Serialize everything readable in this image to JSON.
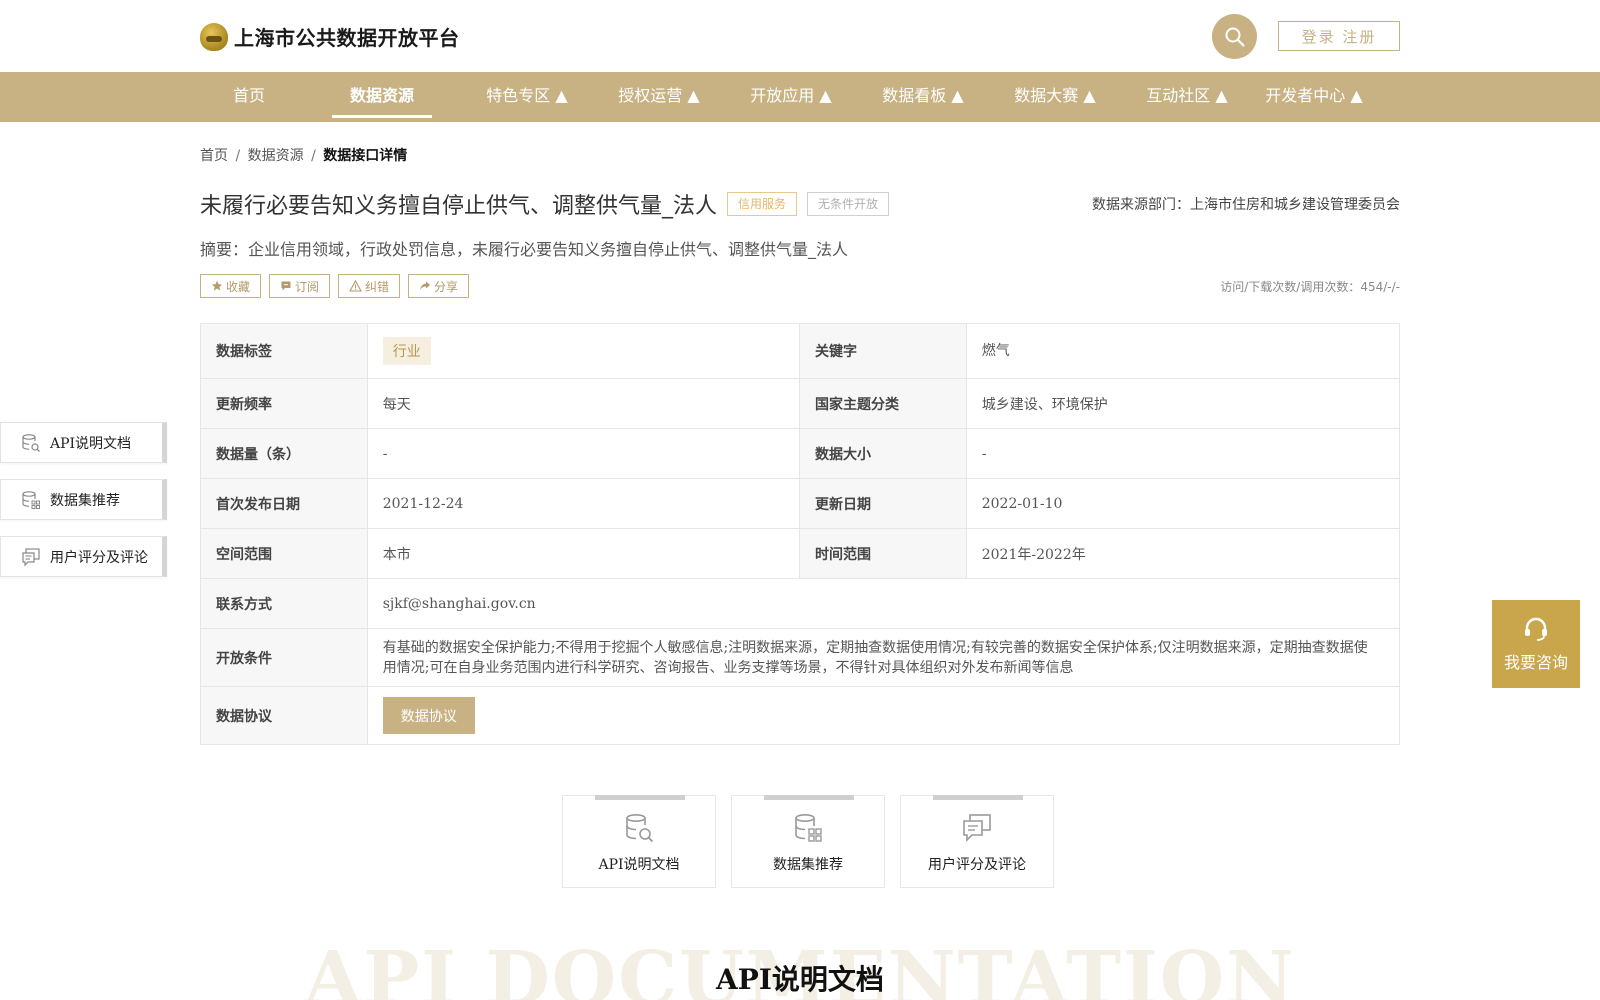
{
  "header": {
    "logo_text": "上海市公共数据开放平台",
    "login_label": "登录 注册",
    "accent_color": "#c8b283"
  },
  "nav": {
    "items": [
      {
        "label": "首页"
      },
      {
        "label": "数据资源"
      },
      {
        "label": "特色专区 ▲"
      },
      {
        "label": "授权运营 ▲"
      },
      {
        "label": "开放应用 ▲"
      },
      {
        "label": "数据看板 ▲"
      },
      {
        "label": "数据大赛 ▲"
      },
      {
        "label": "互动社区 ▲"
      },
      {
        "label": "开发者中心 ▲"
      }
    ],
    "active": "数据资源"
  },
  "breadcrumb": {
    "home": "首页",
    "sep": "/",
    "section": "数据资源",
    "current": "数据接口详情"
  },
  "detail": {
    "title": "未履行必要告知义务擅自停止供气、调整供气量_法人",
    "tag_credit": "信用服务",
    "tag_open": "无条件开放",
    "source": "数据来源部门：上海市住房和城乡建设管理委员会",
    "summary": "摘要：企业信用领域，行政处罚信息，未履行必要告知义务擅自停止供气、调整供气量_法人",
    "actions": {
      "favorite": "收藏",
      "subscribe": "订阅",
      "report": "纠错",
      "share": "分享"
    },
    "stats": "访问/下载次数/调用次数：454/-/-"
  },
  "info": {
    "tags_label": "数据标签",
    "tags_value": "行业",
    "keyword_label": "关键字",
    "keyword_value": "燃气",
    "freq_label": "更新频率",
    "freq_value": "每天",
    "theme_label": "国家主题分类",
    "theme_value": "城乡建设、环境保护",
    "count_label": "数据量（条）",
    "count_value": "-",
    "size_label": "数据大小",
    "size_value": "-",
    "first_pub_label": "首次发布日期",
    "first_pub_value": "2021-12-24",
    "update_label": "更新日期",
    "update_value": "2022-01-10",
    "space_label": "空间范围",
    "space_value": "本市",
    "time_label": "时间范围",
    "time_value": "2021年-2022年",
    "contact_label": "联系方式",
    "contact_value": "sjkf@shanghai.gov.cn",
    "cond_label": "开放条件",
    "cond_value": "有基础的数据安全保护能力;不得用于挖掘个人敏感信息;注明数据来源，定期抽查数据使用情况;有较完善的数据安全保护体系;仅注明数据来源，定期抽查数据使用情况;可在自身业务范围内进行科学研究、咨询报告、业务支撑等场景，不得针对具体组织对外发布新闻等信息",
    "proto_label": "数据协议",
    "proto_button": "数据协议"
  },
  "sidenav": {
    "api_doc": "API说明文档",
    "dataset_rec": "数据集推荐",
    "reviews": "用户评分及评论"
  },
  "consult": {
    "label": "我要咨询",
    "color": "#c9a64b"
  },
  "cards": {
    "api_doc": "API说明文档",
    "dataset_rec": "数据集推荐",
    "reviews": "用户评分及评论"
  },
  "section": {
    "watermark": "API DOCUMENTATION",
    "title": "API说明文档"
  }
}
